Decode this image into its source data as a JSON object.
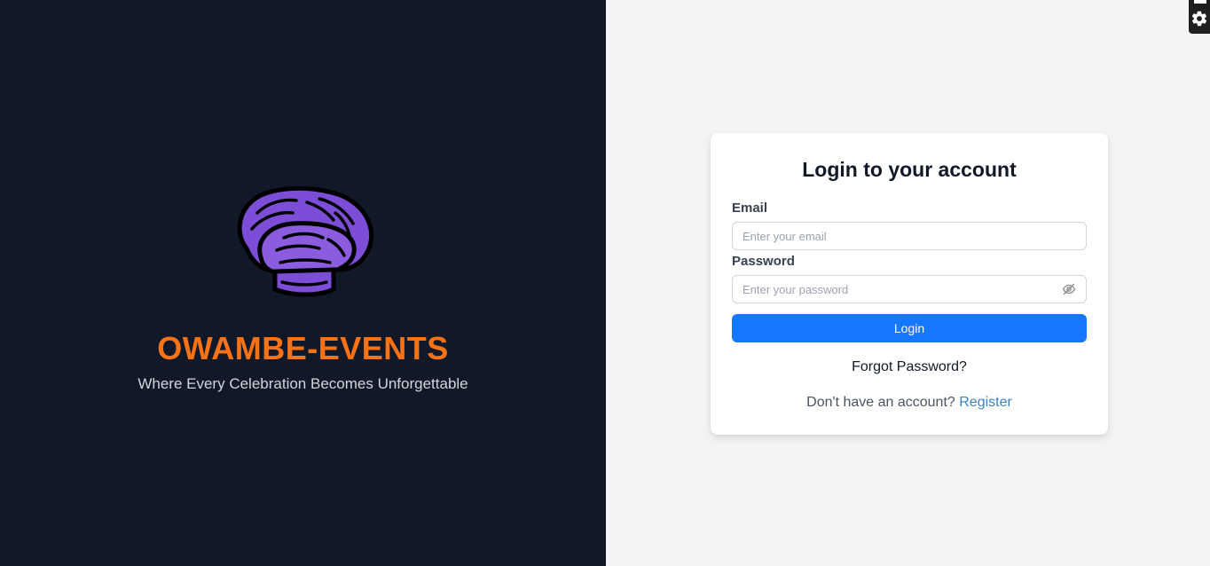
{
  "brand": {
    "name": "OWAMBE-EVENTS",
    "tagline": "Where Every Celebration Becomes Unforgettable",
    "logo_icon": "purple-mushroom-logo-icon"
  },
  "login": {
    "title": "Login to your account",
    "email_label": "Email",
    "email_placeholder": "Enter your email",
    "email_value": "",
    "password_label": "Password",
    "password_placeholder": "Enter your password",
    "password_value": "",
    "toggle_icon": "eye-off-icon",
    "submit_label": "Login",
    "forgot_label": "Forgot Password?",
    "register_prompt": "Don't have an account?",
    "register_label": "Register"
  },
  "corner_widget": {
    "icon": "gear-icon"
  },
  "colors": {
    "left_bg": "#111827",
    "right_bg": "#f3f4f6",
    "brand_orange": "#f97316",
    "primary_blue": "#1677ff",
    "link_blue": "#3b82c4",
    "logo_purple": "#7c4dd6"
  }
}
